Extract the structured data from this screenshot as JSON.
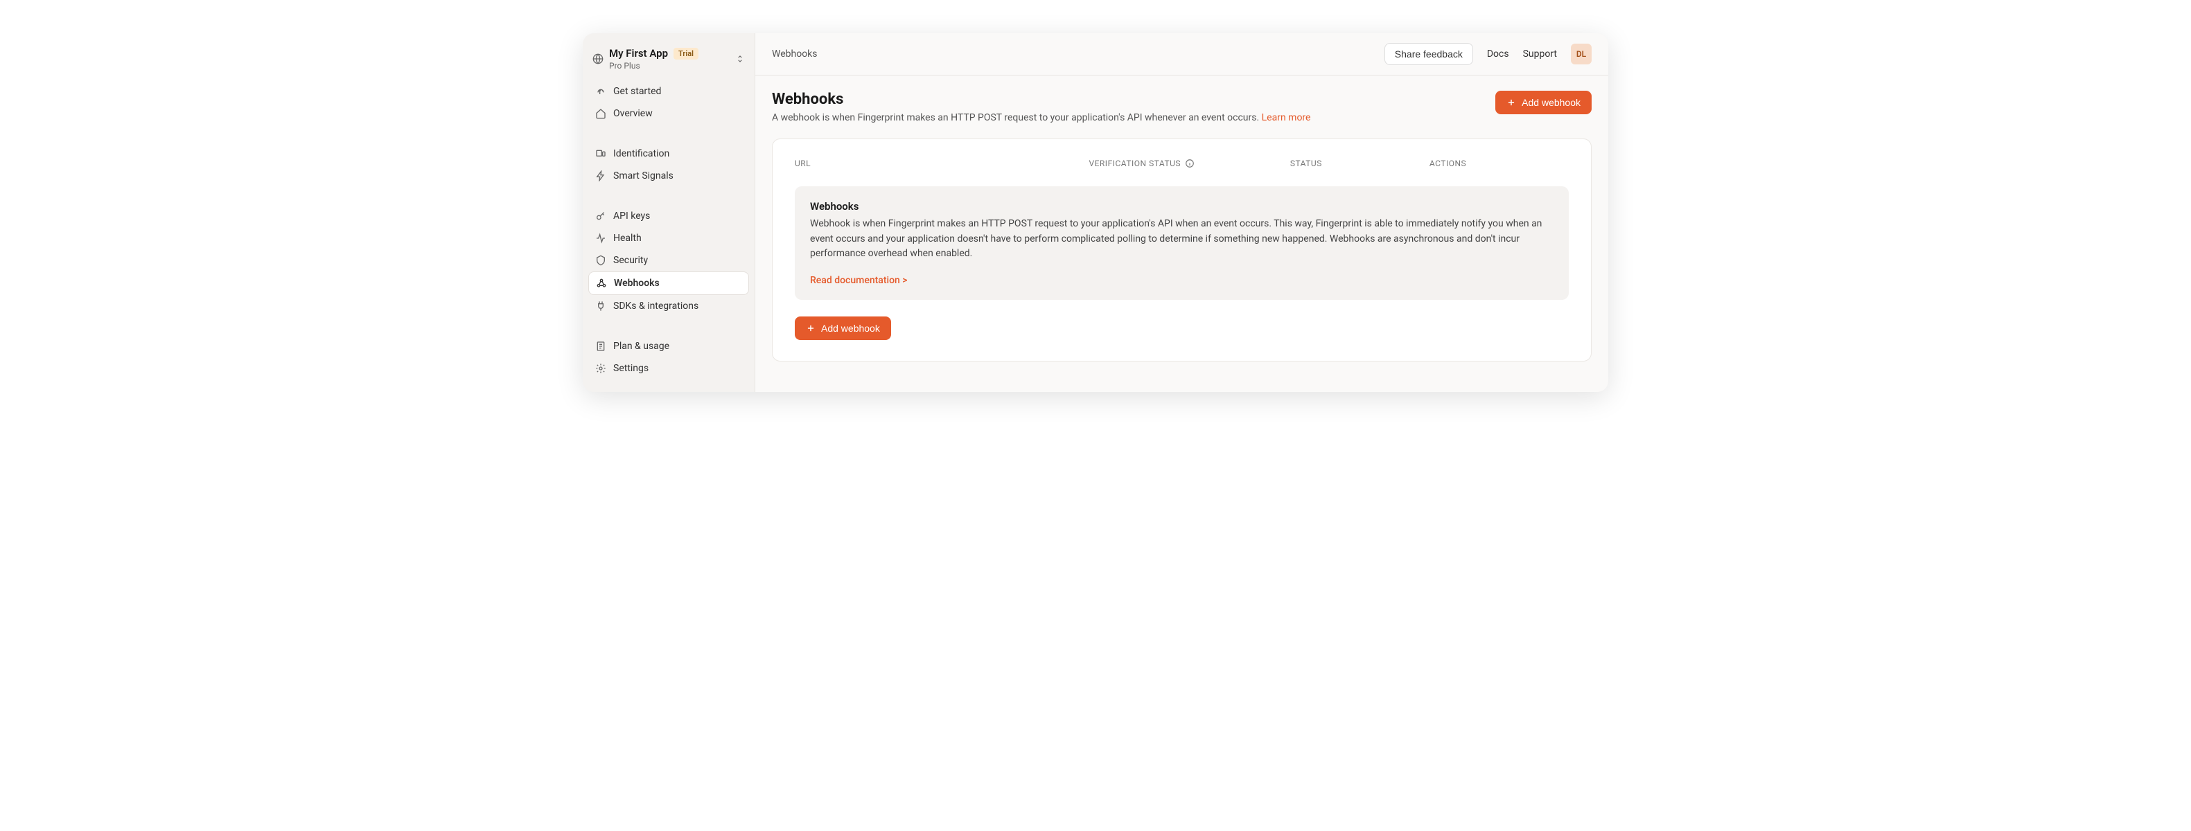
{
  "sidebar": {
    "app_name": "My First App",
    "trial_badge": "Trial",
    "plan": "Pro Plus",
    "sections": [
      [
        {
          "label": "Get started",
          "icon": "fingerprint"
        },
        {
          "label": "Overview",
          "icon": "home"
        }
      ],
      [
        {
          "label": "Identification",
          "icon": "devices"
        },
        {
          "label": "Smart Signals",
          "icon": "bolt"
        }
      ],
      [
        {
          "label": "API keys",
          "icon": "key"
        },
        {
          "label": "Health",
          "icon": "activity"
        },
        {
          "label": "Security",
          "icon": "shield"
        },
        {
          "label": "Webhooks",
          "icon": "webhook",
          "active": true
        },
        {
          "label": "SDKs & integrations",
          "icon": "plug"
        }
      ],
      [
        {
          "label": "Plan & usage",
          "icon": "receipt"
        },
        {
          "label": "Settings",
          "icon": "gear"
        }
      ]
    ]
  },
  "topbar": {
    "breadcrumb": "Webhooks",
    "feedback": "Share feedback",
    "docs": "Docs",
    "support": "Support",
    "avatar": "DL"
  },
  "page": {
    "title": "Webhooks",
    "subtitle": "A webhook is when Fingerprint makes an HTTP POST request to your application's API whenever an event occurs. ",
    "learn_more": "Learn more",
    "add_webhook": "Add webhook"
  },
  "table": {
    "headers": {
      "url": "URL",
      "verification": "VERIFICATION STATUS",
      "status": "STATUS",
      "actions": "ACTIONS"
    }
  },
  "infobox": {
    "title": "Webhooks",
    "body": "Webhook is when Fingerprint makes an HTTP POST request to your application's API when an event occurs. This way, Fingerprint is able to immediately notify you when an event occurs and your application doesn't have to perform complicated polling to determine if something new happened. Webhooks are asynchronous and don't incur performance overhead when enabled.",
    "doc_link": "Read documentation >"
  },
  "bottom_button": "Add webhook"
}
